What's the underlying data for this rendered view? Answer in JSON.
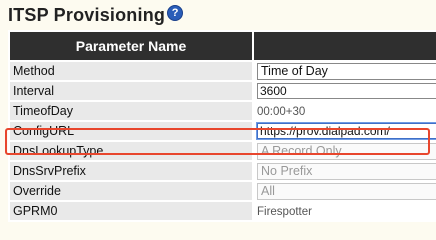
{
  "header": {
    "title": "ITSP Provisioning",
    "help_icon": "question-mark-icon"
  },
  "table": {
    "columns": [
      "Parameter Name",
      ""
    ],
    "rows": [
      {
        "name": "Method",
        "value": "Time of Day",
        "control": "select"
      },
      {
        "name": "Interval",
        "value": "3600",
        "control": "text"
      },
      {
        "name": "TimeofDay",
        "value": "00:00+30",
        "control": "static"
      },
      {
        "name": "ConfigURL",
        "value": "https://prov.dialpad.com/",
        "control": "text-active"
      },
      {
        "name": "DnsLookupType",
        "value": "A Record Only",
        "control": "select-disabled"
      },
      {
        "name": "DnsSrvPrefix",
        "value": "No Prefix",
        "control": "select-disabled"
      },
      {
        "name": "Override",
        "value": "All",
        "control": "select-disabled"
      },
      {
        "name": "GPRM0",
        "value": "Firespotter",
        "control": "static"
      }
    ]
  },
  "colors": {
    "header_bg": "#2f2f2f",
    "name_cell_bg": "#e9e9e9",
    "highlight": "#e8462d",
    "help_icon": "#2a5db8"
  }
}
